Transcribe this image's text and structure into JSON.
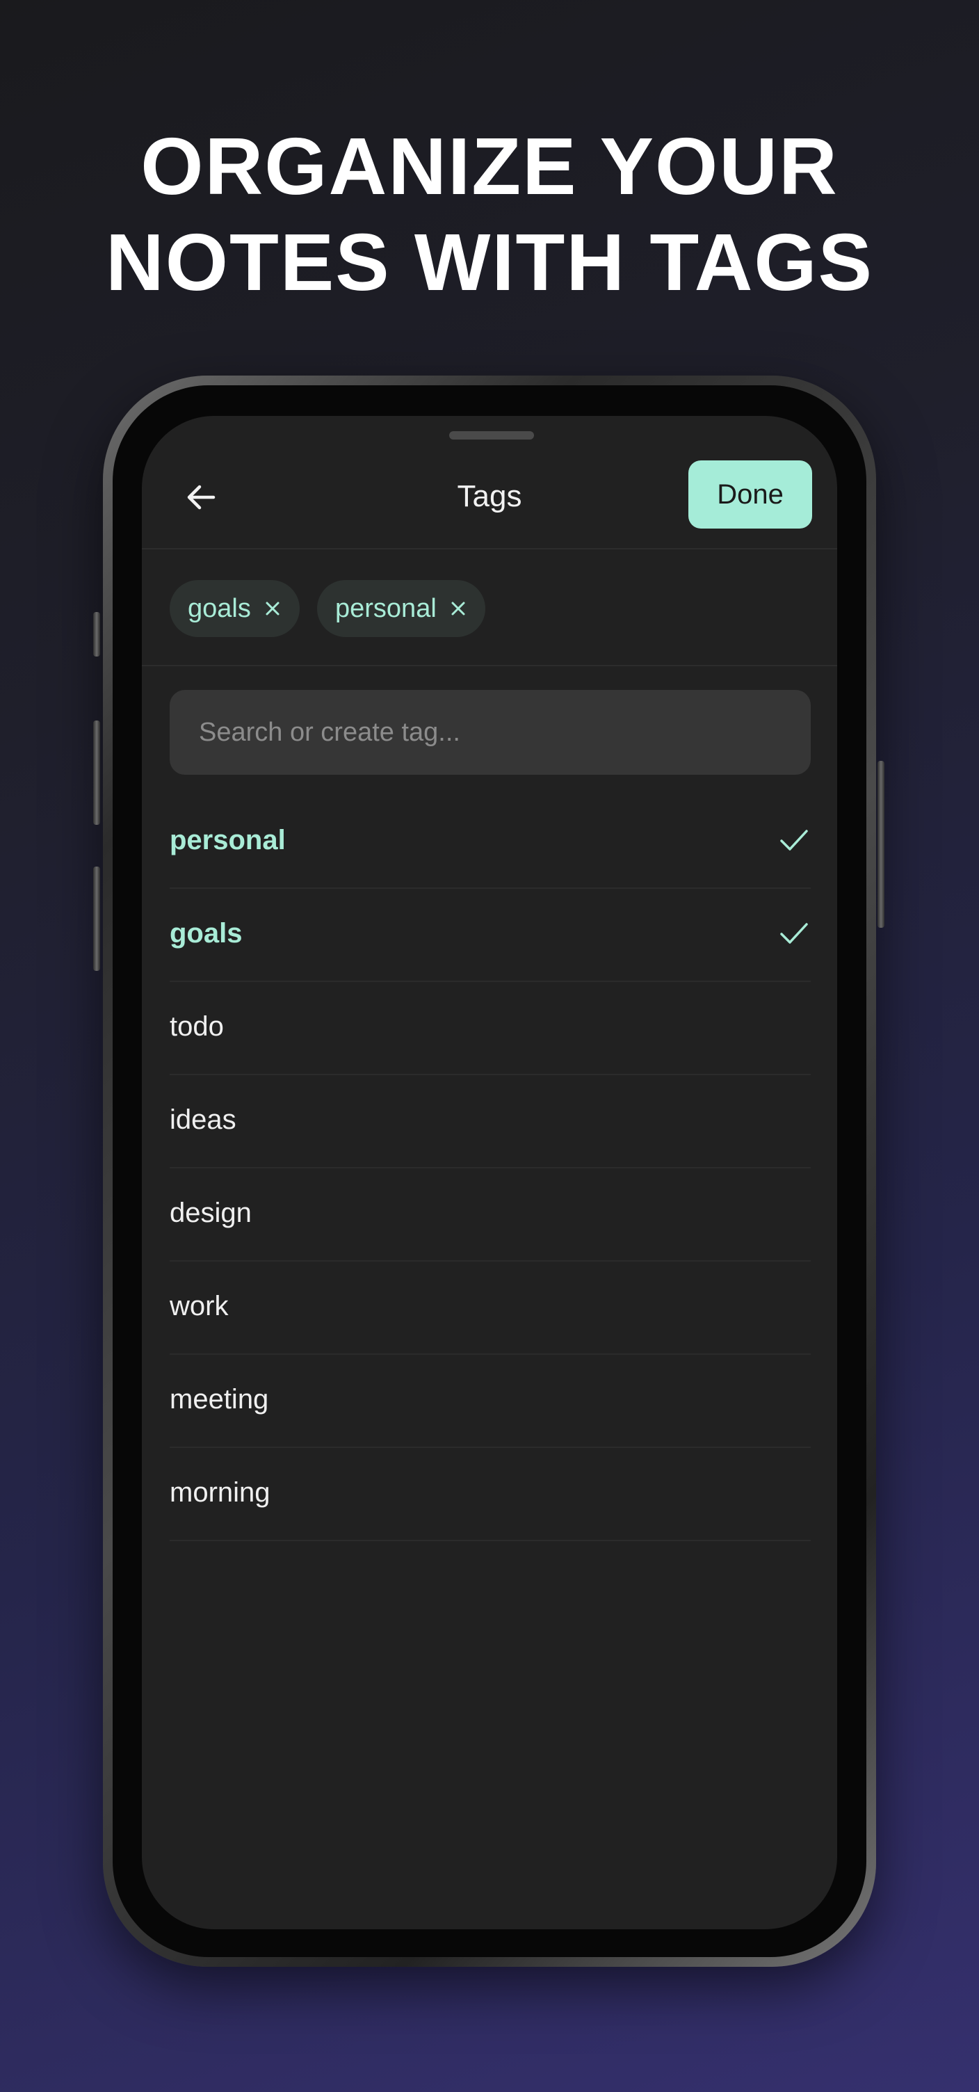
{
  "headline": {
    "line1": "ORGANIZE YOUR",
    "line2": "NOTES WITH TAGS"
  },
  "header": {
    "back_icon": "arrow-left-icon",
    "title": "Tags",
    "done_label": "Done"
  },
  "selected_tags": [
    {
      "label": "goals",
      "remove_icon": "close-icon"
    },
    {
      "label": "personal",
      "remove_icon": "close-icon"
    }
  ],
  "search": {
    "placeholder": "Search or create tag...",
    "value": ""
  },
  "tags": [
    {
      "label": "personal",
      "selected": true
    },
    {
      "label": "goals",
      "selected": true
    },
    {
      "label": "todo",
      "selected": false
    },
    {
      "label": "ideas",
      "selected": false
    },
    {
      "label": "design",
      "selected": false
    },
    {
      "label": "work",
      "selected": false
    },
    {
      "label": "meeting",
      "selected": false
    },
    {
      "label": "morning",
      "selected": false
    }
  ],
  "colors": {
    "accent": "#a5ecd8",
    "accent_text": "#a9ecd7",
    "screen_bg": "#212121",
    "search_bg": "#363636"
  }
}
